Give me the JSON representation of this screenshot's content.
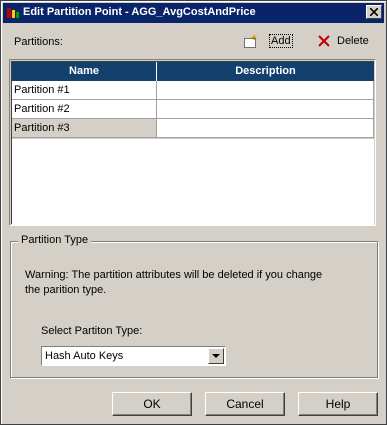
{
  "window": {
    "title": "Edit Partition Point - AGG_AvgCostAndPrice"
  },
  "toolbar": {
    "partitions_label": "Partitions:",
    "add_label": "Add",
    "delete_label": "Delete"
  },
  "grid": {
    "columns": [
      "Name",
      "Description"
    ],
    "rows": [
      {
        "name": "Partition #1",
        "description": ""
      },
      {
        "name": "Partition #2",
        "description": ""
      },
      {
        "name": "Partition #3",
        "description": ""
      }
    ],
    "selected_index": 2
  },
  "partition_type": {
    "group_title": "Partition Type",
    "warning": "Warning: The partition attributes will be deleted if you change the parition type.",
    "select_label": "Select Partiton Type:",
    "selected_value": "Hash Auto Keys"
  },
  "buttons": {
    "ok": "OK",
    "cancel": "Cancel",
    "help": "Help"
  },
  "colors": {
    "titlebar": "#0a246a",
    "grid_header": "#14406e",
    "dialog_bg": "#d4d0c8",
    "delete_icon": "#c00000"
  }
}
